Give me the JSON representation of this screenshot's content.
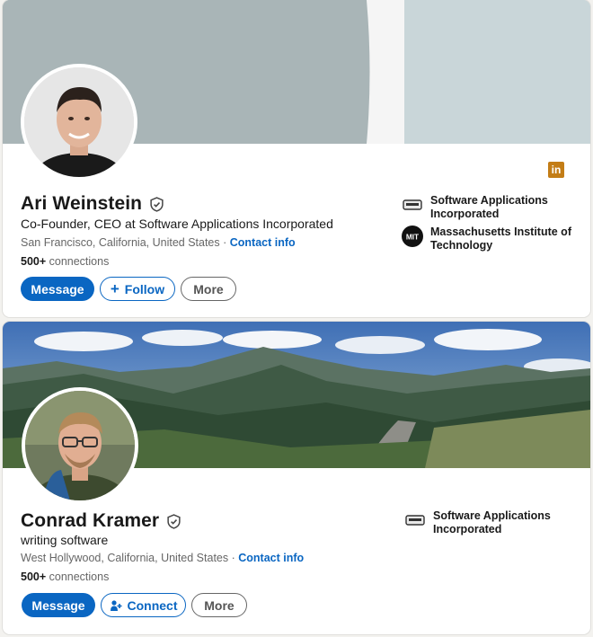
{
  "profiles": [
    {
      "name": "Ari Weinstein",
      "headline": "Co-Founder, CEO at Software Applications Incorporated",
      "location": "San Francisco, California, United States",
      "separator": " · ",
      "contact_label": "Contact info",
      "connections_count": "500+",
      "connections_label": " connections",
      "buttons": {
        "message": "Message",
        "follow": "Follow",
        "more": "More"
      },
      "orgs": [
        {
          "label": "Software Applications Incorporated",
          "icon": "chip-logo-icon"
        },
        {
          "label": "Massachusetts Institute of Technology",
          "icon": "mit-logo-icon",
          "logo_text": "MIT"
        }
      ],
      "badge_icon": "linkedin-icon",
      "badge_text": "in"
    },
    {
      "name": "Conrad Kramer",
      "headline": "writing software",
      "location": "West Hollywood, California, United States",
      "separator": " · ",
      "contact_label": "Contact info",
      "connections_count": "500+",
      "connections_label": " connections",
      "buttons": {
        "message": "Message",
        "connect": "Connect",
        "more": "More"
      },
      "orgs": [
        {
          "label": "Software Applications Incorporated",
          "icon": "chip-logo-icon"
        }
      ]
    }
  ],
  "colors": {
    "accent": "#0a66c2",
    "badge": "#c37d16",
    "banner1": "#a8b4b6"
  }
}
